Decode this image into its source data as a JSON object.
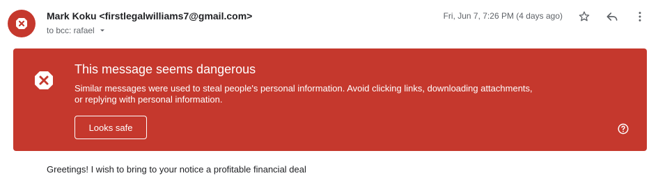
{
  "message": {
    "sender_display": "Mark Koku <firstlegalwilliams7@gmail.com>",
    "recipient_text": "to bcc: rafael",
    "date_text": "Fri, Jun 7, 7:26 PM (4 days ago)",
    "body_text": "Greetings! I wish to bring to your notice a profitable financial deal"
  },
  "warning": {
    "title": "This message seems dangerous",
    "body": "Similar messages were used to steal people's personal information. Avoid clicking links, downloading attachments, or replying with personal information.",
    "safe_button_label": "Looks safe"
  },
  "icons": {
    "avatar": "warning-avatar-icon",
    "star": "star-icon",
    "reply": "reply-icon",
    "more": "more-vertical-icon",
    "dropdown": "chevron-down-icon",
    "warning": "warning-icon",
    "help": "help-icon"
  },
  "colors": {
    "danger_red": "#c5382d",
    "text_primary": "#202124",
    "text_secondary": "#5f6368",
    "banner_text": "#ffffff"
  }
}
